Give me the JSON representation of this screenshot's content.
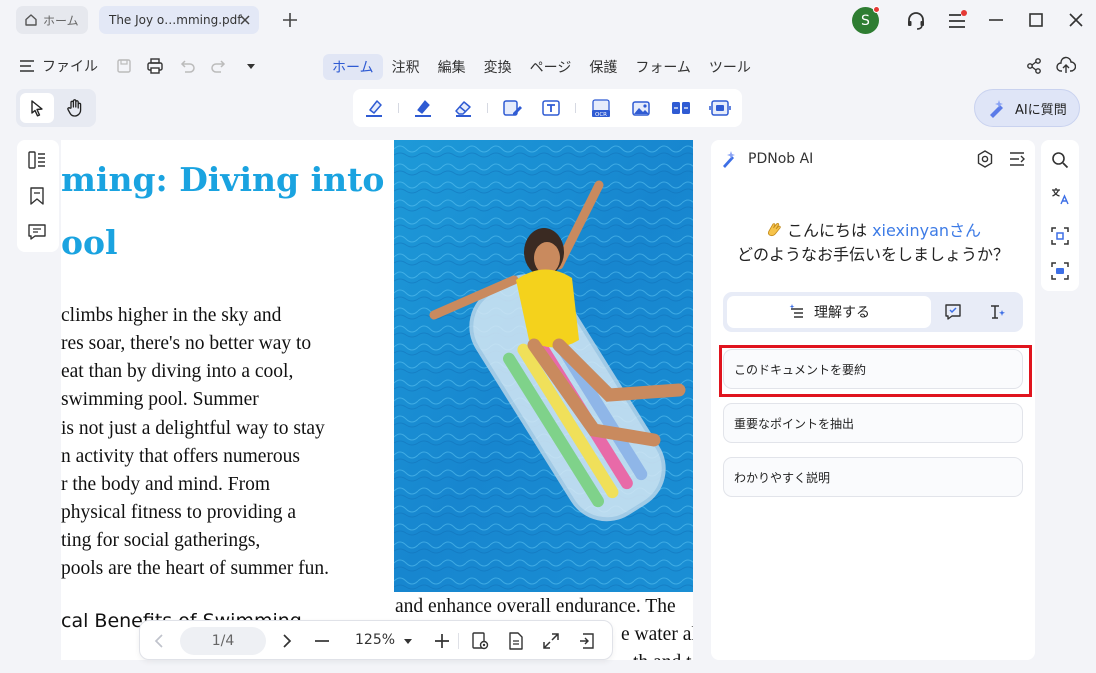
{
  "titlebar": {
    "home_tab": "ホーム",
    "doc_tab": "The Joy o…mming.pdf",
    "avatar_letter": "S"
  },
  "menubar": {
    "file_label": "ファイル",
    "tabs": [
      "ホーム",
      "注釈",
      "編集",
      "変換",
      "ページ",
      "保護",
      "フォーム",
      "ツール"
    ],
    "active_tab": "ホーム"
  },
  "toolbar": {
    "ai_button_label": "AIに質問"
  },
  "document": {
    "title_lines": [
      "ming: Diving into",
      "ool"
    ],
    "body_lines": [
      "climbs higher in the sky and",
      "res soar, there's no better way to",
      "eat than by diving into a cool,",
      "swimming pool. Summer",
      "is not just a delightful way to stay",
      "n activity that offers numerous",
      "r the body and mind. From",
      "physical fitness to providing a",
      "ting for social gatherings,",
      "pools are the heart of summer fun."
    ],
    "section_heading": "cal Benefits of Swimming",
    "right_lines": [
      "and enhance overall endurance. The",
      "e water al",
      "th and t"
    ]
  },
  "navbar": {
    "page_indicator": "1/4",
    "zoom": "125%"
  },
  "ai_panel": {
    "title": "PDNob AI",
    "greeting_prefix": "こんにちは ",
    "user_name": "xiexinyanさん",
    "greeting_question": "どのようなお手伝いをしましょうか？",
    "mode_active_label": "理解する",
    "suggestions": [
      "このドキュメントを要約",
      "重要なポイントを抽出",
      "わかりやすく説明"
    ]
  },
  "colors": {
    "accent": "#2f5bd3",
    "title_blue": "#1aa3e0",
    "highlight_red": "#e0141e"
  }
}
